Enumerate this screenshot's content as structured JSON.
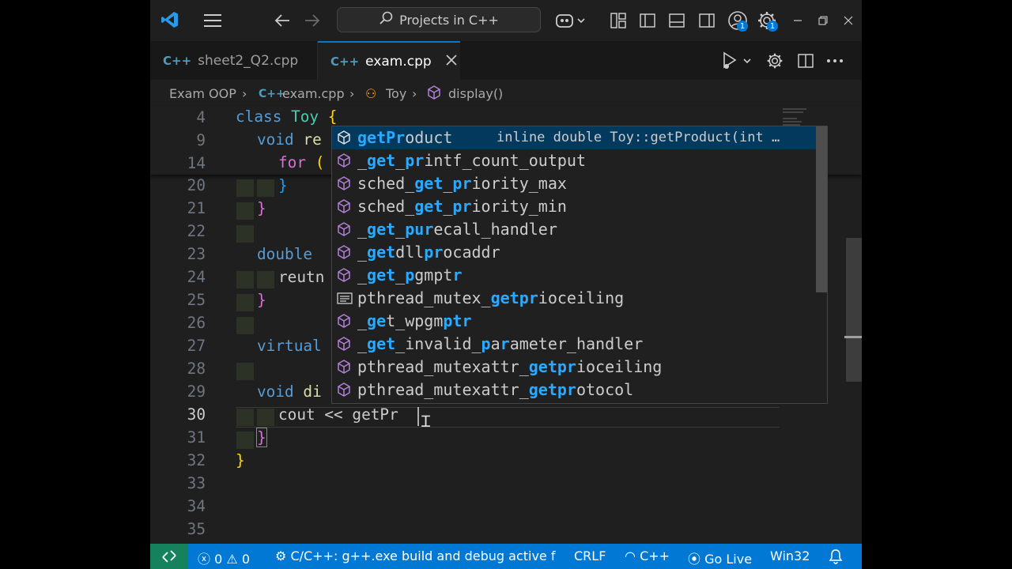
{
  "window": {
    "command_center": "Projects in C++",
    "account_badge": "1",
    "settings_badge": "1"
  },
  "tabs": [
    {
      "label": "sheet2_Q2.cpp",
      "active": false
    },
    {
      "label": "exam.cpp",
      "active": true
    }
  ],
  "breadcrumb": [
    "Exam OOP",
    "exam.cpp",
    "Toy",
    "display()"
  ],
  "editor": {
    "line_numbers": [
      "4",
      "9",
      "14",
      "20",
      "21",
      "22",
      "23",
      "24",
      "25",
      "26",
      "27",
      "28",
      "29",
      "30",
      "31",
      "32",
      "33",
      "34",
      "35"
    ],
    "lines": {
      "l4": [
        "class",
        "Toy",
        "{"
      ],
      "l9": [
        "void",
        "re"
      ],
      "l14": [
        "for",
        "("
      ],
      "l20": "}",
      "l21": "}",
      "l23": "double",
      "l24": "reutn",
      "l25": "}",
      "l27": "virtual",
      "l29": [
        "void",
        "di"
      ],
      "l30": "cout << getPr",
      "l31": "}",
      "l32": "}"
    }
  },
  "suggest": {
    "items": [
      {
        "kind": "method",
        "text": "getProduct",
        "detail": "inline double Toy::getProduct(int …"
      },
      {
        "kind": "method",
        "text": "_get_printf_count_output"
      },
      {
        "kind": "method",
        "text": "sched_get_priority_max"
      },
      {
        "kind": "method",
        "text": "sched_get_priority_min"
      },
      {
        "kind": "method",
        "text": "_get_purecall_handler"
      },
      {
        "kind": "method",
        "text": "_getdllprocaddr"
      },
      {
        "kind": "method",
        "text": "_get_pgmptr"
      },
      {
        "kind": "text",
        "text": "pthread_mutex_getprioceiling"
      },
      {
        "kind": "method",
        "text": "_get_wpgmptr"
      },
      {
        "kind": "method",
        "text": "_get_invalid_parameter_handler"
      },
      {
        "kind": "method",
        "text": "pthread_mutexattr_getprioceiling"
      },
      {
        "kind": "method",
        "text": "pthread_mutexattr_getprotocol"
      }
    ]
  },
  "status": {
    "errors": "0",
    "warnings": "0",
    "task": "C/C++: g++.exe build and debug active f",
    "eol": "CRLF",
    "language": "C++",
    "go_live": "Go Live",
    "config": "Win32"
  },
  "colors": {
    "accent": "#0078d4",
    "remote": "#16825d",
    "match": "#2aaaff"
  }
}
